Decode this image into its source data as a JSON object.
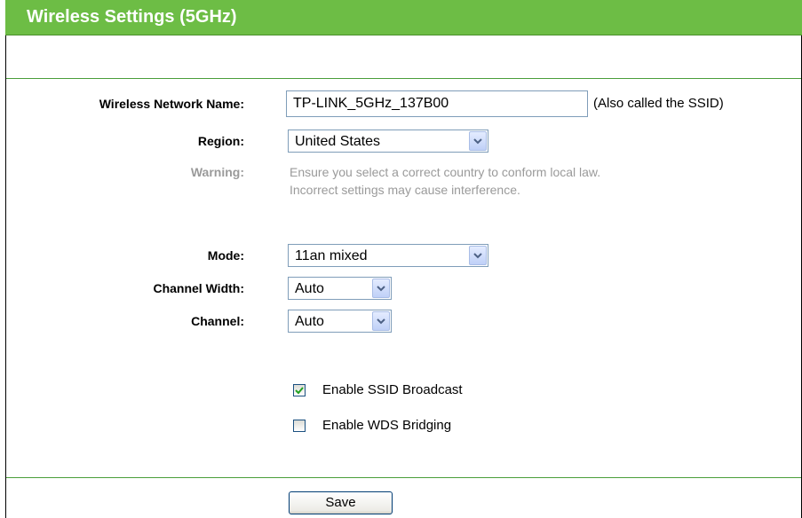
{
  "page": {
    "title": "Wireless Settings (5GHz)"
  },
  "form": {
    "network_name_label": "Wireless Network Name:",
    "network_name_value": "TP-LINK_5GHz_137B00",
    "network_name_note": "(Also called the SSID)",
    "region_label": "Region:",
    "region_value": "United States",
    "warning_label": "Warning:",
    "warning_line1": "Ensure you select a correct country to conform local law.",
    "warning_line2": "Incorrect settings may cause interference.",
    "mode_label": "Mode:",
    "mode_value": "11an mixed",
    "channel_width_label": "Channel Width:",
    "channel_width_value": "Auto",
    "channel_label": "Channel:",
    "channel_value": "Auto",
    "ssid_broadcast_label": "Enable SSID Broadcast",
    "ssid_broadcast_checked": true,
    "wds_label": "Enable WDS Bridging",
    "wds_checked": false,
    "save_label": "Save"
  },
  "colors": {
    "title_bar": "#6dbd45",
    "warning_text": "#9a9a9a",
    "divider": "#4a9e3a"
  },
  "icons": {
    "dropdown": "chevron-down-icon",
    "checkmark": "checkmark-icon"
  }
}
